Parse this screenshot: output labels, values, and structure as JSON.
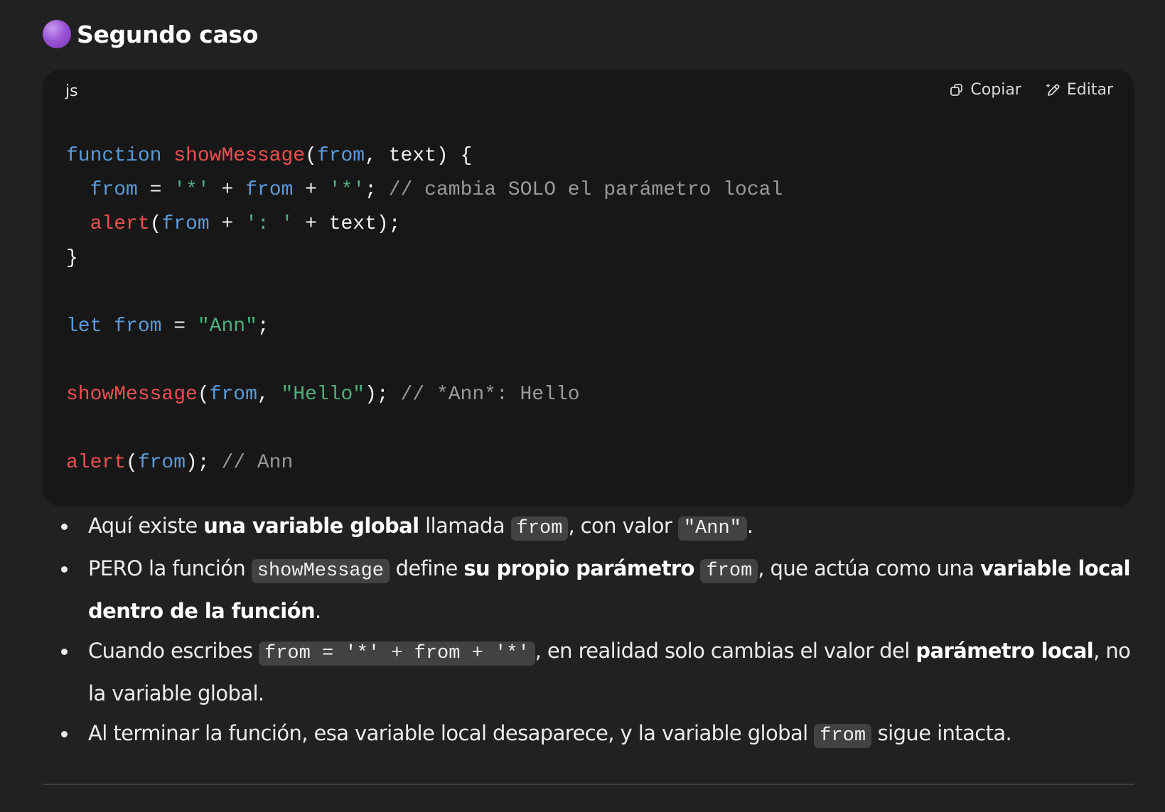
{
  "heading": {
    "text": "Segundo caso",
    "icon": "purple-circle-emoji",
    "icon_color": "#9b56d6"
  },
  "code_block": {
    "language": "js",
    "copy_label": "Copiar",
    "edit_label": "Editar",
    "lines": [
      [
        [
          "kw",
          "function"
        ],
        [
          "plain",
          " "
        ],
        [
          "fn",
          "showMessage"
        ],
        [
          "plain",
          "("
        ],
        [
          "param",
          "from"
        ],
        [
          "plain",
          ", text) {"
        ]
      ],
      [
        [
          "plain",
          "  "
        ],
        [
          "param",
          "from"
        ],
        [
          "plain",
          " = "
        ],
        [
          "str",
          "'*'"
        ],
        [
          "plain",
          " + "
        ],
        [
          "param",
          "from"
        ],
        [
          "plain",
          " + "
        ],
        [
          "str",
          "'*'"
        ],
        [
          "plain",
          "; "
        ],
        [
          "com",
          "// cambia SOLO el parámetro local"
        ]
      ],
      [
        [
          "plain",
          "  "
        ],
        [
          "fn",
          "alert"
        ],
        [
          "plain",
          "("
        ],
        [
          "param",
          "from"
        ],
        [
          "plain",
          " + "
        ],
        [
          "str",
          "': '"
        ],
        [
          "plain",
          " + text);"
        ]
      ],
      [
        [
          "plain",
          "}"
        ]
      ],
      [],
      [
        [
          "kw",
          "let"
        ],
        [
          "plain",
          " "
        ],
        [
          "param",
          "from"
        ],
        [
          "plain",
          " = "
        ],
        [
          "str",
          "\"Ann\""
        ],
        [
          "plain",
          ";"
        ]
      ],
      [],
      [
        [
          "fn",
          "showMessage"
        ],
        [
          "plain",
          "("
        ],
        [
          "param",
          "from"
        ],
        [
          "plain",
          ", "
        ],
        [
          "str",
          "\"Hello\""
        ],
        [
          "plain",
          "); "
        ],
        [
          "com",
          "// *Ann*: Hello"
        ]
      ],
      [],
      [
        [
          "fn",
          "alert"
        ],
        [
          "plain",
          "("
        ],
        [
          "param",
          "from"
        ],
        [
          "plain",
          "); "
        ],
        [
          "com",
          "// Ann"
        ]
      ]
    ]
  },
  "bullets": [
    {
      "t1": "Aquí existe ",
      "b1": "una variable global",
      "t2": " llamada ",
      "c1": "from",
      "t3": ", con valor ",
      "c2": "\"Ann\"",
      "t4": "."
    },
    {
      "t1": "PERO la función ",
      "c1": "showMessage",
      "t2": " define ",
      "b1": "su propio parámetro",
      "t3": " ",
      "c2": "from",
      "t4": ", que actúa como una ",
      "b2": "variable local dentro de la función",
      "t5": "."
    },
    {
      "t1": "Cuando escribes ",
      "c1": "from = '*' + from + '*'",
      "t2": ", en realidad solo cambias el valor del ",
      "b1": "parámetro local",
      "t3": ", no la variable global."
    },
    {
      "t1": "Al terminar la función, esa variable local desaparece, y la variable global ",
      "c1": "from",
      "t2": " sigue intacta."
    }
  ],
  "colors": {
    "background": "#212121",
    "code_background": "#171717",
    "keyword": "#5a9bdc",
    "function": "#e8514f",
    "string": "#4fb07e",
    "comment": "#9a9a9a",
    "inline_code_bg": "#424242"
  }
}
